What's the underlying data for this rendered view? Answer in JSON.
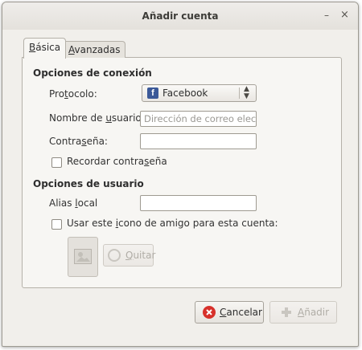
{
  "window": {
    "title": "Añadir cuenta",
    "minimize_glyph": "–",
    "close_glyph": "×"
  },
  "tabs": [
    {
      "label_pre": "",
      "mnemonic": "B",
      "label_post": "ásica",
      "active": true
    },
    {
      "label_pre": "",
      "mnemonic": "A",
      "label_post": "vanzadas",
      "active": false
    }
  ],
  "connection": {
    "heading": "Opciones de conexión",
    "protocol_label_pre": "Pro",
    "protocol_label_mn": "t",
    "protocol_label_post": "ocolo:",
    "protocol_value": "Facebook",
    "protocol_icon_glyph": "f",
    "username_label_pre": "Nombre de ",
    "username_label_mn": "u",
    "username_label_post": "suario:",
    "username_placeholder": "Dirección de correo electrónico",
    "password_label_pre": "Contra",
    "password_label_mn": "s",
    "password_label_post": "eña:",
    "password_value": "",
    "remember_label_pre": "Recordar contra",
    "remember_label_mn": "s",
    "remember_label_post": "eña",
    "remember_checked": false
  },
  "user_options": {
    "heading": "Opciones de usuario",
    "alias_label_pre": "Alias ",
    "alias_label_mn": "l",
    "alias_label_post": "ocal",
    "alias_value": "",
    "buddy_icon_label_pre": "Usar este ",
    "buddy_icon_label_mn": "i",
    "buddy_icon_label_post": "cono de amigo para esta cuenta:",
    "buddy_icon_checked": false,
    "remove_button_mn": "Q",
    "remove_button_post": "uitar",
    "remove_button_enabled": false
  },
  "buttons": {
    "cancel_mn": "C",
    "cancel_post": "ancelar",
    "add_mn": "A",
    "add_post": "ñadir",
    "add_enabled": false
  },
  "colors": {
    "cancel_icon": "#d7312b",
    "add_icon_disabled": "#c9c6c0",
    "facebook": "#3b5998"
  }
}
